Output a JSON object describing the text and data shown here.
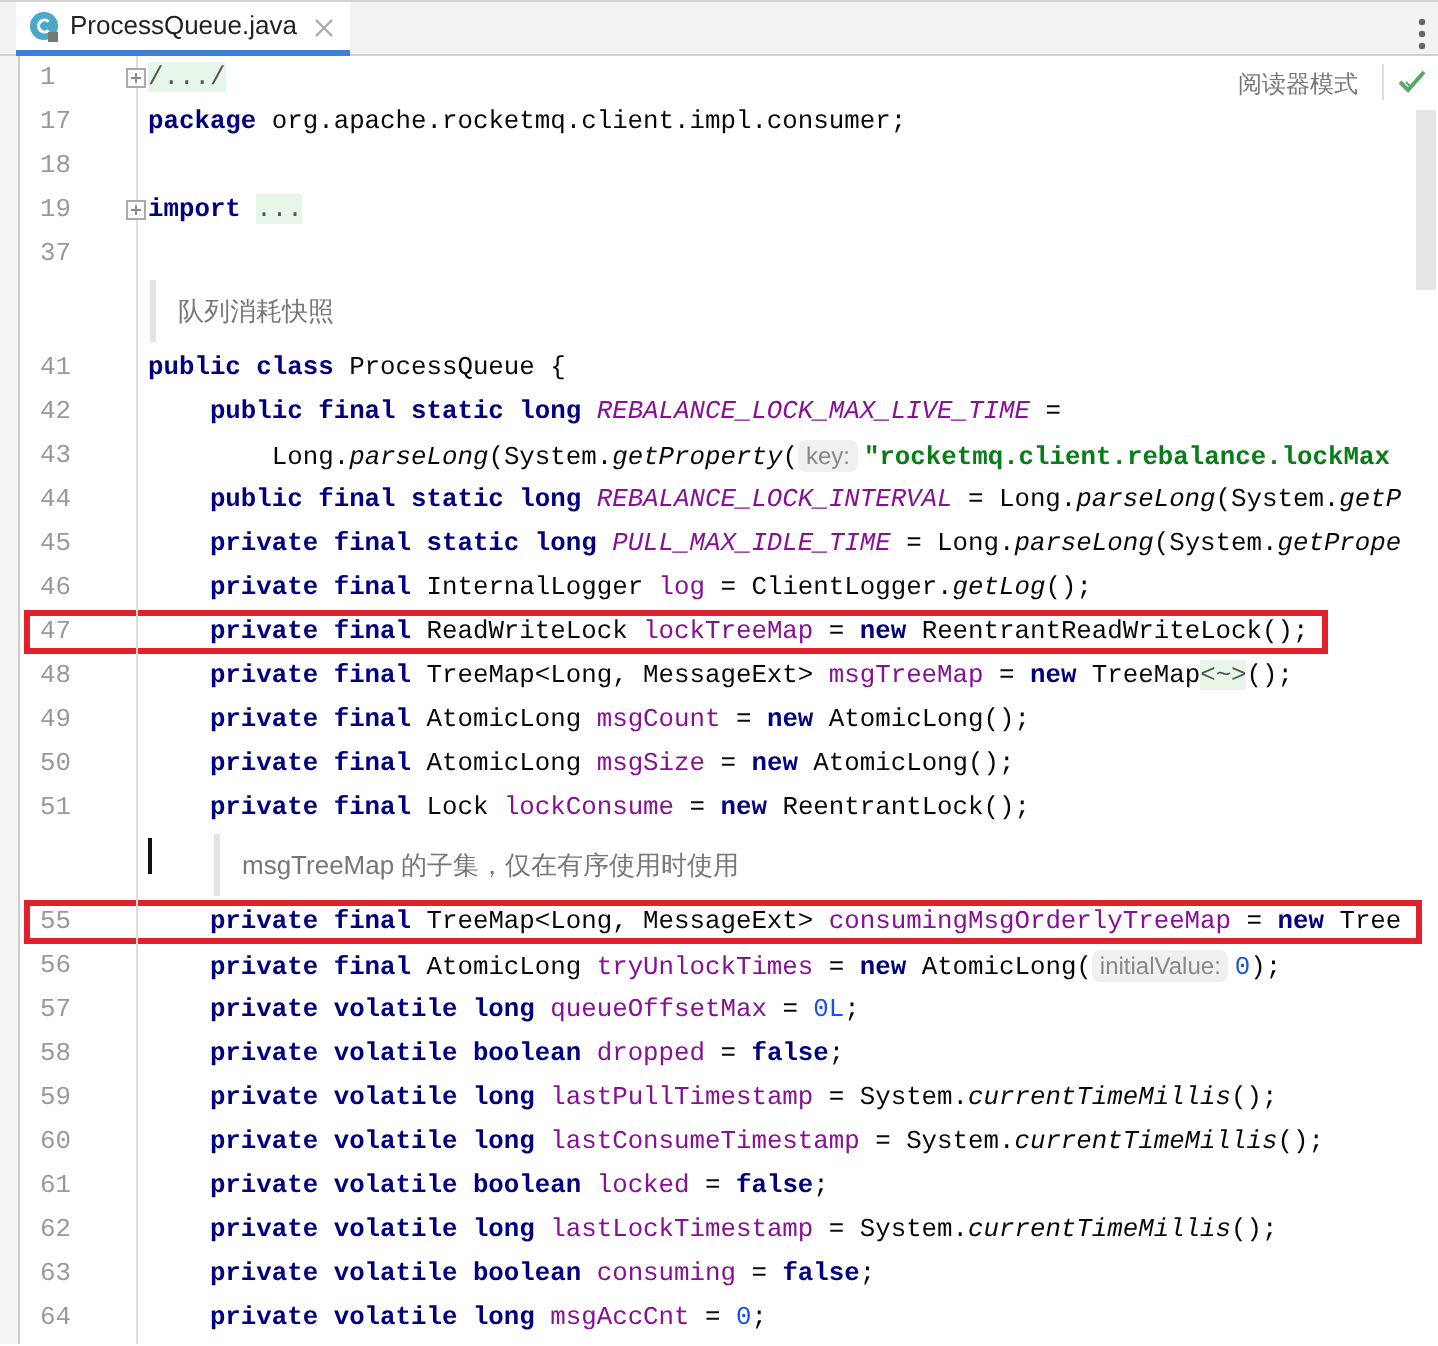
{
  "tab": {
    "title": "ProcessQueue.java",
    "selected": true
  },
  "reader_mode": "阅读器模式",
  "lines": [
    {
      "kind": "code",
      "number": "1",
      "fold": true,
      "highlighted": false,
      "tokens": [
        {
          "kind": "folded",
          "text": "/.../"
        }
      ]
    },
    {
      "kind": "code",
      "number": "17",
      "fold": false,
      "highlighted": false,
      "tokens": [
        {
          "kind": "kw",
          "text": "package"
        },
        {
          "kind": "plain",
          "text": " org.apache.rocketmq.client.impl.consumer;"
        }
      ]
    },
    {
      "kind": "code",
      "number": "18",
      "fold": false,
      "highlighted": false
    },
    {
      "kind": "code",
      "number": "19",
      "fold": true,
      "highlighted": false,
      "tokens": [
        {
          "kind": "kw",
          "text": "import "
        },
        {
          "kind": "folded",
          "text": "..."
        }
      ]
    },
    {
      "kind": "code",
      "number": "37",
      "fold": false,
      "highlighted": false
    },
    {
      "kind": "doc",
      "text": "队列消耗快照",
      "cursor": false
    },
    {
      "kind": "code",
      "number": "41",
      "fold": false,
      "highlighted": false,
      "tokens": [
        {
          "kind": "kw",
          "text": "public class"
        },
        {
          "kind": "plain",
          "text": " ProcessQueue {"
        }
      ]
    },
    {
      "kind": "code",
      "number": "42",
      "fold": false,
      "highlighted": false,
      "tokens": [
        {
          "kind": "kw",
          "text": "    public final static long "
        },
        {
          "kind": "static",
          "text": "REBALANCE_LOCK_MAX_LIVE_TIME"
        },
        {
          "kind": "plain",
          "text": " ="
        }
      ]
    },
    {
      "kind": "code",
      "number": "43",
      "fold": false,
      "highlighted": false,
      "tokens": [
        {
          "kind": "plain",
          "text": "        Long."
        },
        {
          "kind": "call",
          "text": "parseLong"
        },
        {
          "kind": "plain",
          "text": "(System."
        },
        {
          "kind": "call",
          "text": "getProperty"
        },
        {
          "kind": "plain",
          "text": "("
        },
        {
          "kind": "hint",
          "text": "key:"
        },
        {
          "kind": "str",
          "text": "\"rocketmq.client.rebalance.lockMax"
        }
      ]
    },
    {
      "kind": "code",
      "number": "44",
      "fold": false,
      "highlighted": false,
      "tokens": [
        {
          "kind": "kw",
          "text": "    public final static long "
        },
        {
          "kind": "static",
          "text": "REBALANCE_LOCK_INTERVAL"
        },
        {
          "kind": "plain",
          "text": " = Long."
        },
        {
          "kind": "call",
          "text": "parseLong"
        },
        {
          "kind": "plain",
          "text": "(System."
        },
        {
          "kind": "call",
          "text": "getP"
        }
      ]
    },
    {
      "kind": "code",
      "number": "45",
      "fold": false,
      "highlighted": false,
      "tokens": [
        {
          "kind": "kw",
          "text": "    private final static long "
        },
        {
          "kind": "static",
          "text": "PULL_MAX_IDLE_TIME"
        },
        {
          "kind": "plain",
          "text": " = Long."
        },
        {
          "kind": "call",
          "text": "parseLong"
        },
        {
          "kind": "plain",
          "text": "(System."
        },
        {
          "kind": "call",
          "text": "getPrope"
        }
      ]
    },
    {
      "kind": "code",
      "number": "46",
      "fold": false,
      "highlighted": false,
      "tokens": [
        {
          "kind": "kw",
          "text": "    private final "
        },
        {
          "kind": "plain",
          "text": "InternalLogger "
        },
        {
          "kind": "field",
          "text": "log"
        },
        {
          "kind": "plain",
          "text": " = ClientLogger."
        },
        {
          "kind": "call",
          "text": "getLog"
        },
        {
          "kind": "plain",
          "text": "();"
        }
      ]
    },
    {
      "kind": "code",
      "number": "47",
      "fold": false,
      "highlighted": true,
      "tokens": [
        {
          "kind": "kw",
          "text": "    private final "
        },
        {
          "kind": "plain",
          "text": "ReadWriteLock "
        },
        {
          "kind": "field",
          "text": "lockTreeMap"
        },
        {
          "kind": "plain",
          "text": " = "
        },
        {
          "kind": "kw",
          "text": "new"
        },
        {
          "kind": "plain",
          "text": " ReentrantReadWriteLock();"
        }
      ]
    },
    {
      "kind": "code",
      "number": "48",
      "fold": false,
      "highlighted": false,
      "tokens": [
        {
          "kind": "kw",
          "text": "    private final "
        },
        {
          "kind": "plain",
          "text": "TreeMap<Long, MessageExt> "
        },
        {
          "kind": "field",
          "text": "msgTreeMap"
        },
        {
          "kind": "plain",
          "text": " = "
        },
        {
          "kind": "kw",
          "text": "new"
        },
        {
          "kind": "plain",
          "text": " TreeMap"
        },
        {
          "kind": "folded",
          "text": "<~>"
        },
        {
          "kind": "plain",
          "text": "();"
        }
      ]
    },
    {
      "kind": "code",
      "number": "49",
      "fold": false,
      "highlighted": false,
      "tokens": [
        {
          "kind": "kw",
          "text": "    private final "
        },
        {
          "kind": "plain",
          "text": "AtomicLong "
        },
        {
          "kind": "field",
          "text": "msgCount"
        },
        {
          "kind": "plain",
          "text": " = "
        },
        {
          "kind": "kw",
          "text": "new"
        },
        {
          "kind": "plain",
          "text": " AtomicLong();"
        }
      ]
    },
    {
      "kind": "code",
      "number": "50",
      "fold": false,
      "highlighted": false,
      "tokens": [
        {
          "kind": "kw",
          "text": "    private final "
        },
        {
          "kind": "plain",
          "text": "AtomicLong "
        },
        {
          "kind": "field",
          "text": "msgSize"
        },
        {
          "kind": "plain",
          "text": " = "
        },
        {
          "kind": "kw",
          "text": "new"
        },
        {
          "kind": "plain",
          "text": " AtomicLong();"
        }
      ]
    },
    {
      "kind": "code",
      "number": "51",
      "fold": false,
      "highlighted": false,
      "tokens": [
        {
          "kind": "kw",
          "text": "    private final "
        },
        {
          "kind": "plain",
          "text": "Lock "
        },
        {
          "kind": "field",
          "text": "lockConsume"
        },
        {
          "kind": "plain",
          "text": " = "
        },
        {
          "kind": "kw",
          "text": "new"
        },
        {
          "kind": "plain",
          "text": " ReentrantLock();"
        }
      ]
    },
    {
      "kind": "member-doc",
      "text": "msgTreeMap 的子集，仅在有序使用时使用",
      "cursor": true
    },
    {
      "kind": "code",
      "number": "55",
      "fold": false,
      "highlighted": true,
      "tokens": [
        {
          "kind": "kw",
          "text": "    private final "
        },
        {
          "kind": "plain",
          "text": "TreeMap<Long, MessageExt> "
        },
        {
          "kind": "field",
          "text": "consumingMsgOrderlyTreeMap"
        },
        {
          "kind": "plain",
          "text": " = "
        },
        {
          "kind": "kw",
          "text": "new"
        },
        {
          "kind": "plain",
          "text": " Tree"
        }
      ]
    },
    {
      "kind": "code",
      "number": "56",
      "fold": false,
      "highlighted": false,
      "tokens": [
        {
          "kind": "kw",
          "text": "    private final "
        },
        {
          "kind": "plain",
          "text": "AtomicLong "
        },
        {
          "kind": "field",
          "text": "tryUnlockTimes"
        },
        {
          "kind": "plain",
          "text": " = "
        },
        {
          "kind": "kw",
          "text": "new"
        },
        {
          "kind": "plain",
          "text": " AtomicLong("
        },
        {
          "kind": "hint",
          "text": "initialValue:"
        },
        {
          "kind": "num",
          "text": "0"
        },
        {
          "kind": "plain",
          "text": ");"
        }
      ]
    },
    {
      "kind": "code",
      "number": "57",
      "fold": false,
      "highlighted": false,
      "tokens": [
        {
          "kind": "kw",
          "text": "    private volatile long "
        },
        {
          "kind": "field",
          "text": "queueOffsetMax"
        },
        {
          "kind": "plain",
          "text": " = "
        },
        {
          "kind": "num",
          "text": "0L"
        },
        {
          "kind": "plain",
          "text": ";"
        }
      ]
    },
    {
      "kind": "code",
      "number": "58",
      "fold": false,
      "highlighted": false,
      "tokens": [
        {
          "kind": "kw",
          "text": "    private volatile boolean "
        },
        {
          "kind": "field",
          "text": "dropped"
        },
        {
          "kind": "plain",
          "text": " = "
        },
        {
          "kind": "kw",
          "text": "false"
        },
        {
          "kind": "plain",
          "text": ";"
        }
      ]
    },
    {
      "kind": "code",
      "number": "59",
      "fold": false,
      "highlighted": false,
      "tokens": [
        {
          "kind": "kw",
          "text": "    private volatile long "
        },
        {
          "kind": "field",
          "text": "lastPullTimestamp"
        },
        {
          "kind": "plain",
          "text": " = System."
        },
        {
          "kind": "call",
          "text": "currentTimeMillis"
        },
        {
          "kind": "plain",
          "text": "();"
        }
      ]
    },
    {
      "kind": "code",
      "number": "60",
      "fold": false,
      "highlighted": false,
      "tokens": [
        {
          "kind": "kw",
          "text": "    private volatile long "
        },
        {
          "kind": "field",
          "text": "lastConsumeTimestamp"
        },
        {
          "kind": "plain",
          "text": " = System."
        },
        {
          "kind": "call",
          "text": "currentTimeMillis"
        },
        {
          "kind": "plain",
          "text": "();"
        }
      ]
    },
    {
      "kind": "code",
      "number": "61",
      "fold": false,
      "highlighted": false,
      "tokens": [
        {
          "kind": "kw",
          "text": "    private volatile boolean "
        },
        {
          "kind": "field",
          "text": "locked"
        },
        {
          "kind": "plain",
          "text": " = "
        },
        {
          "kind": "kw",
          "text": "false"
        },
        {
          "kind": "plain",
          "text": ";"
        }
      ]
    },
    {
      "kind": "code",
      "number": "62",
      "fold": false,
      "highlighted": false,
      "tokens": [
        {
          "kind": "kw",
          "text": "    private volatile long "
        },
        {
          "kind": "field",
          "text": "lastLockTimestamp"
        },
        {
          "kind": "plain",
          "text": " = System."
        },
        {
          "kind": "call",
          "text": "currentTimeMillis"
        },
        {
          "kind": "plain",
          "text": "();"
        }
      ]
    },
    {
      "kind": "code",
      "number": "63",
      "fold": false,
      "highlighted": false,
      "tokens": [
        {
          "kind": "kw",
          "text": "    private volatile boolean "
        },
        {
          "kind": "field",
          "text": "consuming"
        },
        {
          "kind": "plain",
          "text": " = "
        },
        {
          "kind": "kw",
          "text": "false"
        },
        {
          "kind": "plain",
          "text": ";"
        }
      ]
    },
    {
      "kind": "code",
      "number": "64",
      "fold": false,
      "highlighted": false,
      "tokens": [
        {
          "kind": "kw",
          "text": "    private volatile long "
        },
        {
          "kind": "field",
          "text": "msgAccCnt"
        },
        {
          "kind": "plain",
          "text": " = "
        },
        {
          "kind": "num",
          "text": "0"
        },
        {
          "kind": "plain",
          "text": ";"
        }
      ]
    }
  ]
}
